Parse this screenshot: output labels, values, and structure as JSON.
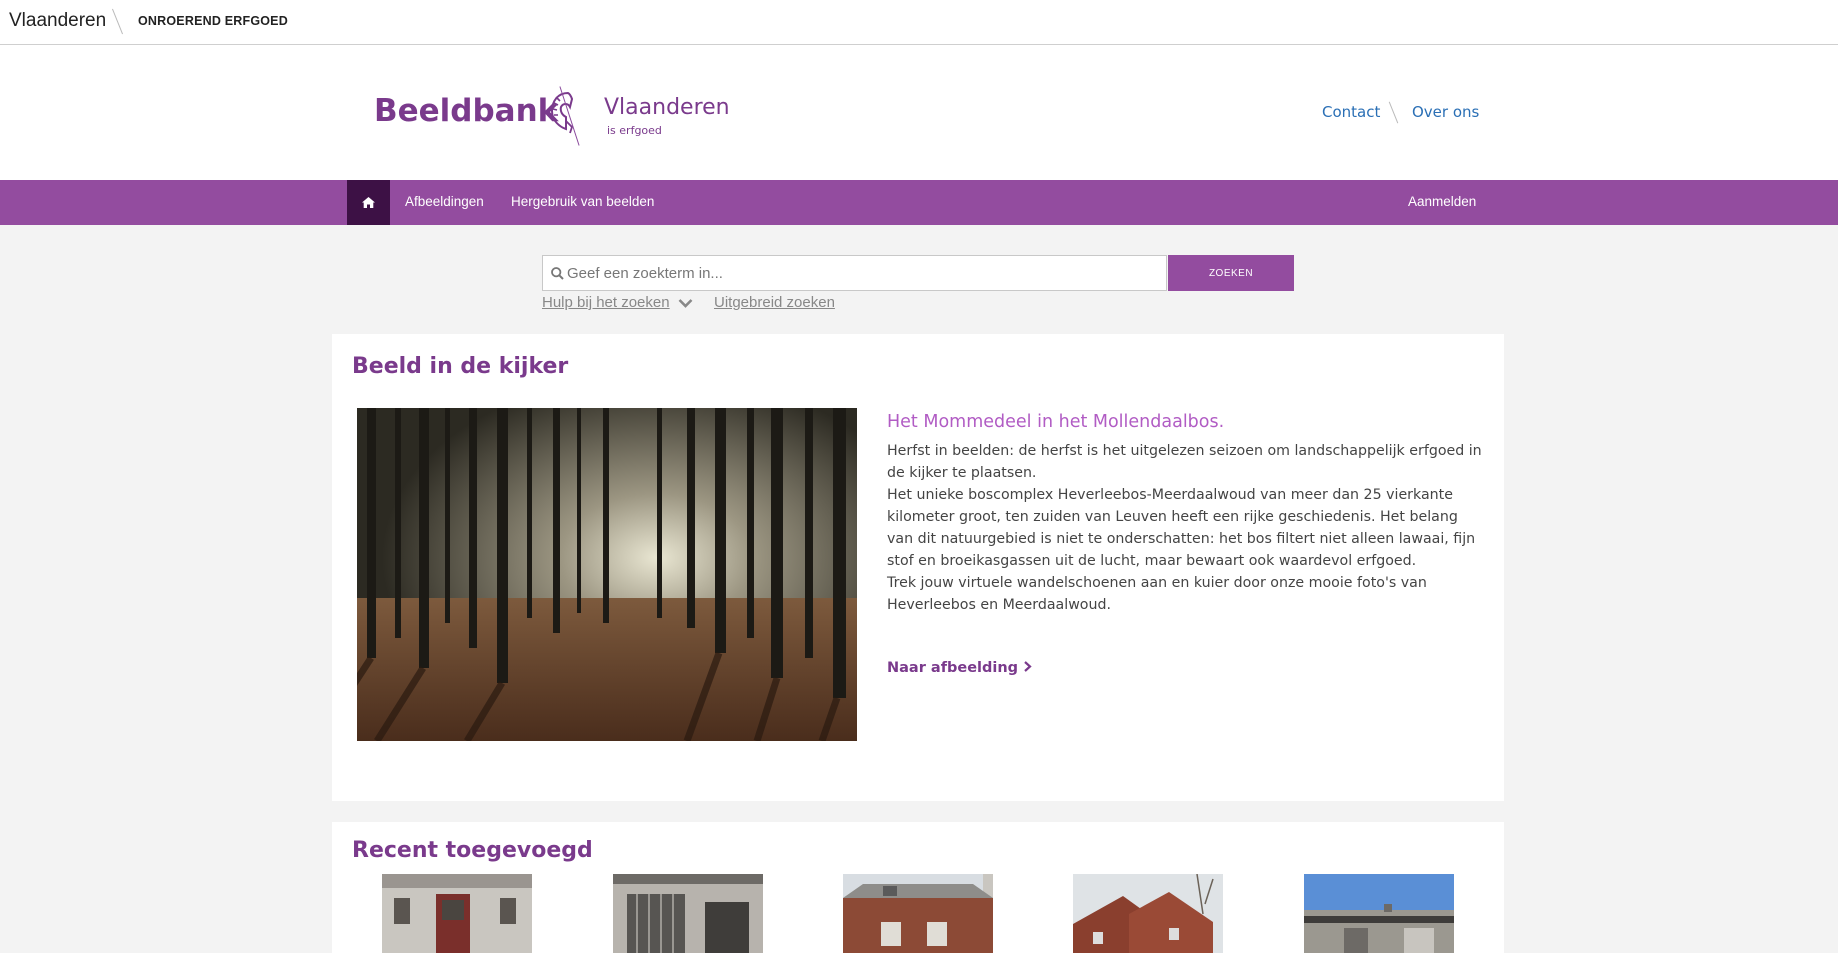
{
  "topbar": {
    "brand": "Vlaanderen",
    "sub": "ONROEREND ERFGOED"
  },
  "header": {
    "title": "Beeldbank",
    "logo_name": "Vlaanderen",
    "logo_tagline": "is erfgoed",
    "links": {
      "contact": "Contact",
      "about": "Over ons"
    }
  },
  "nav": {
    "home_icon": "home-icon",
    "items": [
      "Afbeeldingen",
      "Hergebruik van beelden"
    ],
    "login": "Aanmelden"
  },
  "search": {
    "placeholder": "Geef een zoekterm in...",
    "button": "ZOEKEN",
    "help": "Hulp bij het zoeken",
    "advanced": "Uitgebreid zoeken"
  },
  "featured": {
    "heading": "Beeld in de kijker",
    "title": "Het Mommedeel in het Mollendaalbos.",
    "paragraphs": [
      "Herfst in beelden: de herfst is het uitgelezen seizoen om landschappelijk erfgoed in de kijker te plaatsen.",
      "Het unieke boscomplex Heverleebos-Meerdaalwoud van meer dan 25 vierkante kilometer groot, ten zuiden van Leuven heeft een rijke geschiedenis. Het belang van dit natuurgebied is niet te onderschatten: het bos filtert niet alleen lawaai, fijn stof en broeikasgassen uit de lucht, maar bewaart ook waardevol erfgoed.",
      "Trek jouw virtuele wandelschoenen aan en kuier door onze mooie foto's van Heverleebos en Meerdaalwoud."
    ],
    "link": "Naar afbeelding"
  },
  "recent": {
    "heading": "Recent toegevoegd"
  },
  "colors": {
    "brand_purple": "#934c9f",
    "dark_purple": "#3d1145",
    "title_purple": "#7a3a8c",
    "link_blue": "#2a6fb5"
  }
}
